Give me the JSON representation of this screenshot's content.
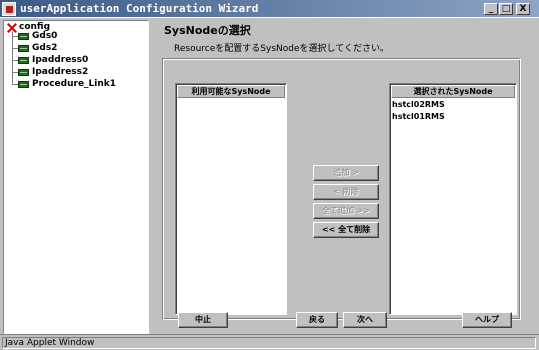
{
  "window": {
    "title": "userApplication Configuration Wizard",
    "minimize": "_",
    "maximize": "□",
    "close": "X"
  },
  "tree": {
    "root": "config",
    "children": [
      "Gds0",
      "Gds2",
      "Ipaddress0",
      "Ipaddress2",
      "Procedure_Link1"
    ]
  },
  "page": {
    "heading": "SysNodeの選択",
    "description": "Resourceを配置するSysNodeを選択してください。"
  },
  "available": {
    "header": "利用可能なSysNode",
    "items": []
  },
  "selected": {
    "header": "選択されたSysNode",
    "items": [
      "hstcl02RMS",
      "hstcl01RMS"
    ]
  },
  "buttons": {
    "add": "追加 >",
    "remove": "< 削除",
    "add_all": "全て追加 >>",
    "remove_all": "<< 全て削除",
    "cancel": "中止",
    "back": "戻る",
    "next": "次へ",
    "help": "ヘルプ"
  },
  "statusbar": {
    "text": "Java Applet Window"
  },
  "colors": {
    "titlebar": "#3b5a86",
    "background": "#c0c0c0"
  }
}
